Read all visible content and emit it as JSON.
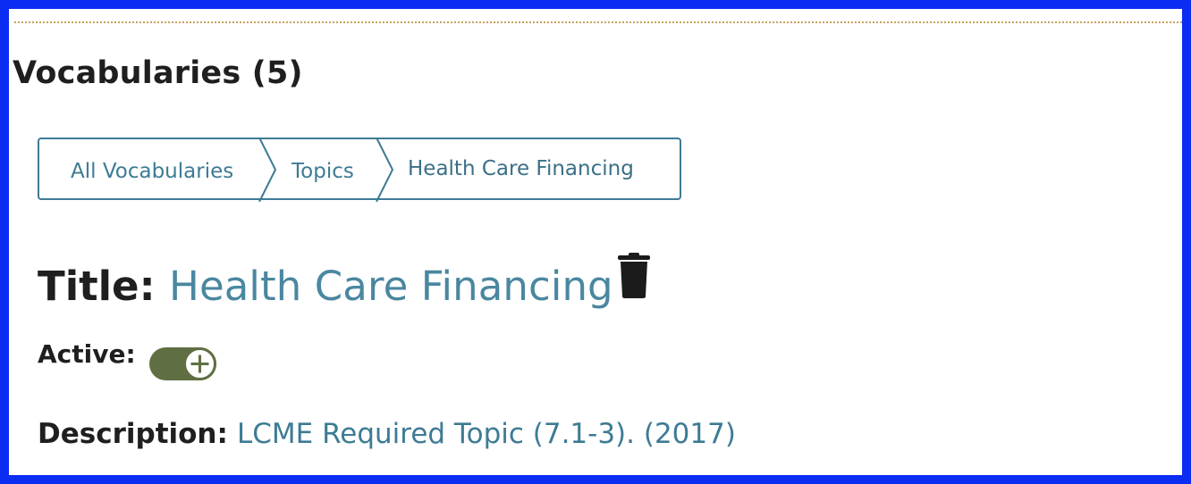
{
  "page": {
    "heading": "Vocabularies (5)"
  },
  "breadcrumb": {
    "items": [
      {
        "label": "All Vocabularies"
      },
      {
        "label": "Topics"
      },
      {
        "label": "Health Care Financing"
      }
    ]
  },
  "detail": {
    "title_label": "Title:",
    "title_value": "Health Care Financing",
    "active_label": "Active:",
    "active_value": true,
    "description_label": "Description:",
    "description_value": "LCME Required Topic (7.1-3). (2017)"
  },
  "icons": {
    "delete": "trash-icon",
    "toggle": "plus-circle-icon"
  },
  "colors": {
    "frame": "#0b2cf2",
    "link": "#3d7b95",
    "title_link": "#4a87a0",
    "toggle_on": "#5f6f43",
    "dotted_rule": "#c8a15a"
  }
}
